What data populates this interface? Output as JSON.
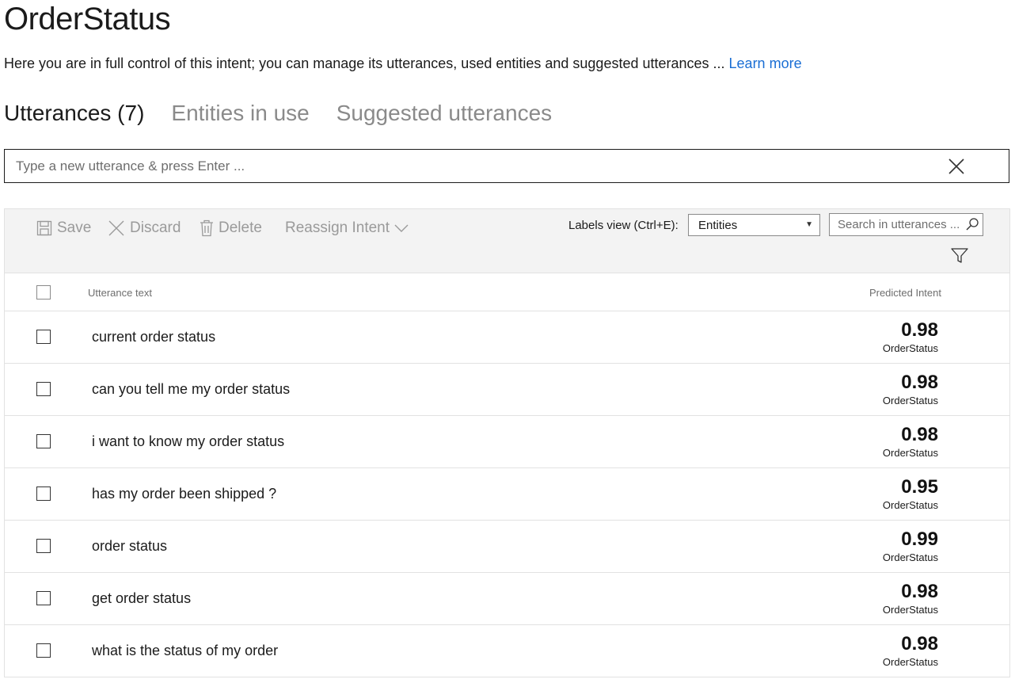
{
  "page": {
    "title": "OrderStatus",
    "description": "Here you are in full control of this intent; you can manage its utterances, used entities and suggested utterances ... ",
    "learn_more": "Learn more"
  },
  "tabs": [
    {
      "label": "Utterances (7)",
      "active": true
    },
    {
      "label": "Entities in use",
      "active": false
    },
    {
      "label": "Suggested utterances",
      "active": false
    }
  ],
  "utterance_input": {
    "placeholder": "Type a new utterance & press Enter ...",
    "value": ""
  },
  "toolbar": {
    "save_label": "Save",
    "discard_label": "Discard",
    "delete_label": "Delete",
    "reassign_label": "Reassign Intent",
    "labels_view_label": "Labels view (Ctrl+E):",
    "labels_view_value": "Entities",
    "search_placeholder": "Search in utterances ..."
  },
  "grid": {
    "columns": {
      "utterance": "Utterance text",
      "intent": "Predicted Intent"
    },
    "rows": [
      {
        "text": "current order status",
        "score": "0.98",
        "intent": "OrderStatus"
      },
      {
        "text": "can you tell me my order status",
        "score": "0.98",
        "intent": "OrderStatus"
      },
      {
        "text": "i want to know my order status",
        "score": "0.98",
        "intent": "OrderStatus"
      },
      {
        "text": "has my order been shipped ?",
        "score": "0.95",
        "intent": "OrderStatus"
      },
      {
        "text": "order status",
        "score": "0.99",
        "intent": "OrderStatus"
      },
      {
        "text": "get order status",
        "score": "0.98",
        "intent": "OrderStatus"
      },
      {
        "text": "what is the status of my order",
        "score": "0.98",
        "intent": "OrderStatus"
      }
    ]
  },
  "colors": {
    "link": "#1a6ed4",
    "toolbar_bg": "#f3f3f3",
    "disabled_text": "#9a9a9a"
  }
}
